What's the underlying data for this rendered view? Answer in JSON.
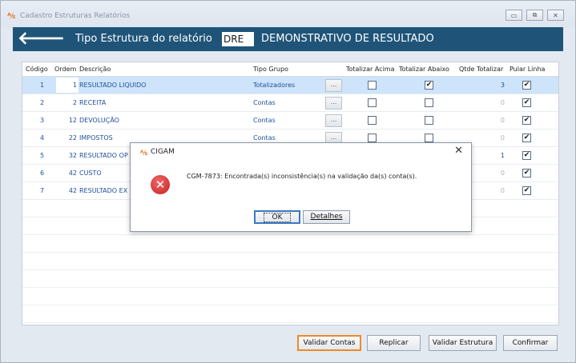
{
  "window": {
    "title": "Cadastro Estruturas Relatórios",
    "app_icon": "cigam-logo-icon",
    "controls": [
      "▭",
      "⧉",
      "✕"
    ]
  },
  "header": {
    "back_icon": "arrow-left-icon",
    "label": "Tipo Estrutura do relatório",
    "code": "DRE",
    "description": "DEMONSTRATIVO DE RESULTADO"
  },
  "grid": {
    "columns": [
      "Código",
      "Ordem",
      "Descrição",
      "Tipo Grupo",
      "Totalizar Acima",
      "Totalizar Abaixo",
      "Qtde Totalizar",
      "Pular Linha"
    ],
    "rows": [
      {
        "codigo": "1",
        "ordem": "1",
        "descricao": "RESULTADO LIQUIDO",
        "tipo": "Totalizadores",
        "acima": false,
        "abaixo": true,
        "qtde": "3",
        "pular": true,
        "selected": true
      },
      {
        "codigo": "2",
        "ordem": "2",
        "descricao": "RECEITA",
        "tipo": "Contas",
        "acima": false,
        "abaixo": false,
        "qtde": "0",
        "pular": true
      },
      {
        "codigo": "3",
        "ordem": "12",
        "descricao": "DEVOLUÇÃO",
        "tipo": "Contas",
        "acima": false,
        "abaixo": false,
        "qtde": "0",
        "pular": true
      },
      {
        "codigo": "4",
        "ordem": "22",
        "descricao": "IMPOSTOS",
        "tipo": "Contas",
        "acima": false,
        "abaixo": false,
        "qtde": "0",
        "pular": true
      },
      {
        "codigo": "5",
        "ordem": "32",
        "descricao": "RESULTADO OP",
        "tipo": "",
        "acima": false,
        "abaixo": false,
        "qtde": "1",
        "pular": true
      },
      {
        "codigo": "6",
        "ordem": "42",
        "descricao": "CUSTO",
        "tipo": "",
        "acima": false,
        "abaixo": false,
        "qtde": "0",
        "pular": true
      },
      {
        "codigo": "7",
        "ordem": "42",
        "descricao": "RESULTADO EX",
        "tipo": "",
        "acima": false,
        "abaixo": false,
        "qtde": "0",
        "pular": true
      }
    ],
    "dots_label": "..."
  },
  "dialog": {
    "title": "CIGAM",
    "close": "✕",
    "message": "CGM-7873: Encontrada(s) inconsistência(s) na validação da(s) conta(s).",
    "ok_label": "OK",
    "details_label": "Detalhes",
    "error_icon": "error-x-icon"
  },
  "footer": {
    "validar_contas": "Validar Contas",
    "replicar": "Replicar",
    "validar_estrutura": "Validar Estrutura",
    "confirmar": "Confirmar"
  },
  "colors": {
    "header_bg": "#1f5478",
    "selected_row": "#cde4fa",
    "highlight_border": "#f08a24",
    "link_text": "#1f4f9a"
  }
}
